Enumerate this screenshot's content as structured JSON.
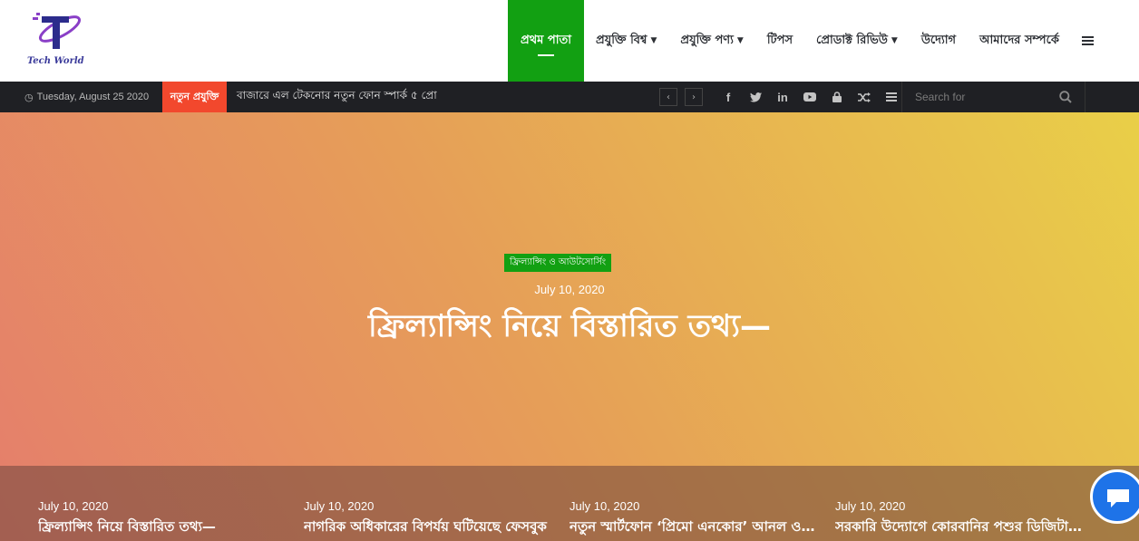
{
  "header": {
    "logo_text": "Tech World",
    "nav": [
      {
        "label": "প্রথম পাতা",
        "active": true,
        "dropdown": false
      },
      {
        "label": "প্রযুক্তি বিশ্ব",
        "active": false,
        "dropdown": true
      },
      {
        "label": "প্রযুক্তি পণ্য",
        "active": false,
        "dropdown": true
      },
      {
        "label": "টিপস",
        "active": false,
        "dropdown": false
      },
      {
        "label": "প্রোডাক্ট রিভিউ",
        "active": false,
        "dropdown": true
      },
      {
        "label": "উদ্যোগ",
        "active": false,
        "dropdown": false
      },
      {
        "label": "আমাদের সম্পর্কে",
        "active": false,
        "dropdown": false
      }
    ],
    "menu_icon": "hamburger-icon"
  },
  "topbar": {
    "date": "Tuesday, August 25 2020",
    "breaking_label": "নতুন প্রযুক্তি",
    "breaking_text": "বাজারে এল টেকনোর নতুন ফোন স্পার্ক ৫ প্রো",
    "social_icons": [
      "facebook-icon",
      "twitter-icon",
      "linkedin-icon",
      "youtube-icon",
      "lock-icon",
      "shuffle-icon",
      "menu-icon"
    ],
    "search_placeholder": "Search for"
  },
  "hero": {
    "category": "ফ্রিল্যান্সিং ও আউটসোর্সিং",
    "date": "July 10, 2020",
    "title": "ফ্রিল্যান্সিং নিয়ে বিস্তারিত তথ্য—"
  },
  "posts": [
    {
      "date": "July 10, 2020",
      "title": "ফ্রিল্যান্সিং নিয়ে বিস্তারিত তথ্য—"
    },
    {
      "date": "July 10, 2020",
      "title": "নাগরিক অধিকারের বিপর্যয় ঘটিয়েছে ফেসবুক"
    },
    {
      "date": "July 10, 2020",
      "title": "নতুন স্মার্টফোন ‘প্রিমো এনকোর’ আনল ওয়ালটন"
    },
    {
      "date": "July 10, 2020",
      "title": "সরকারি উদ্যোগে কোরবানির পশুর ডিজিটাল হাট"
    }
  ],
  "colors": {
    "accent": "#12a012",
    "breaking": "#f2482d",
    "topbar": "#1f2024",
    "chat": "#1e73e8"
  }
}
